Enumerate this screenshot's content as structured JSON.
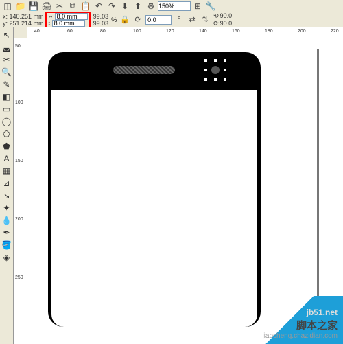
{
  "topbar": {
    "zoom": "150%"
  },
  "position": {
    "x_label": "x:",
    "x": "140.251 mm",
    "y_label": "y:",
    "y": "251.214 mm"
  },
  "size": {
    "w": "8.0 mm",
    "h": "8.0 mm"
  },
  "scale": {
    "sx": "99.03",
    "sy": "99.03",
    "unit": "%"
  },
  "rotation": {
    "value": "0.0",
    "unit": "°"
  },
  "skew": {
    "h": "90.0",
    "v": "90.0"
  },
  "ruler_h": [
    "40",
    "60",
    "80",
    "100",
    "120",
    "140",
    "160",
    "180",
    "200",
    "220"
  ],
  "ruler_v": [
    "50",
    "100",
    "150",
    "200",
    "250"
  ],
  "watermark": {
    "title": "脚本之家",
    "subtitle": "jiaocheng.chazidian.com",
    "alt": "jb51.net"
  }
}
